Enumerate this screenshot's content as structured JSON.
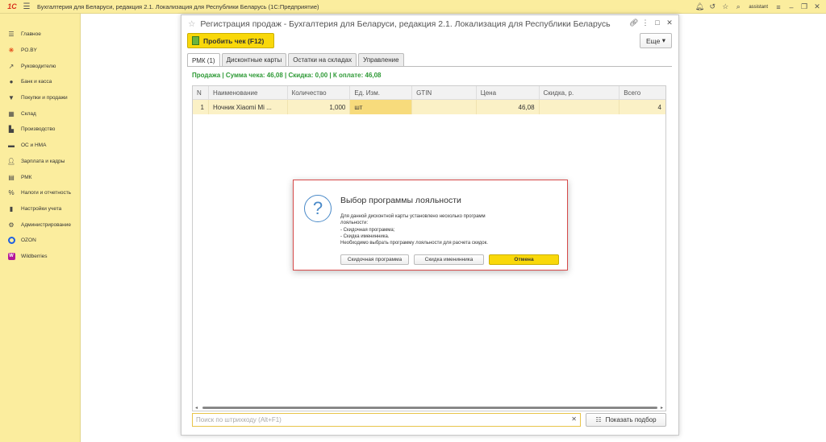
{
  "app": {
    "logo_text": "1С",
    "title": "Бухгалтерия для Беларуси, редакция 2.1. Локализация для Республики Беларусь   (1С:Предприятие)",
    "user": "assistant"
  },
  "sidebar": {
    "items": [
      {
        "label": "Главное",
        "icon": "menu-icon"
      },
      {
        "label": "PO.BY",
        "icon": "poby-icon"
      },
      {
        "label": "Руководителю",
        "icon": "chart-icon"
      },
      {
        "label": "Банк и касса",
        "icon": "bank-icon"
      },
      {
        "label": "Покупки и продажи",
        "icon": "cart-icon"
      },
      {
        "label": "Склад",
        "icon": "warehouse-icon"
      },
      {
        "label": "Производство",
        "icon": "factory-icon"
      },
      {
        "label": "ОС и НМА",
        "icon": "truck-icon"
      },
      {
        "label": "Зарплата и кадры",
        "icon": "person-icon"
      },
      {
        "label": "РМК",
        "icon": "cash-register-icon"
      },
      {
        "label": "Налоги и отчетность",
        "icon": "percent-icon"
      },
      {
        "label": "Настройки учета",
        "icon": "book-icon"
      },
      {
        "label": "Администрирование",
        "icon": "gear-icon"
      },
      {
        "label": "OZON",
        "icon": "ozon-icon"
      },
      {
        "label": "Wildberries",
        "icon": "wildberries-icon"
      }
    ]
  },
  "window": {
    "title": "Регистрация продаж - Бухгалтерия для Беларуси, редакция 2.1. Локализация для Республики Беларусь",
    "print_button": "Пробить чек (F12)",
    "more_button": "Еще",
    "tabs": [
      "РМК (1)",
      "Дисконтные карты",
      "Остатки на складах",
      "Управление"
    ],
    "summary": "Продажа | Сумма чека: 46,08 | Скидка: 0,00 | К оплате: 46,08",
    "columns": [
      "N",
      "Наименование",
      "Количество",
      "Ед. Изм.",
      "GTIN",
      "Цена",
      "Скидка, р.",
      "Всего"
    ],
    "rows": [
      {
        "n": "1",
        "name": "Ночник Xiaomi Mi ...",
        "qty": "1,000",
        "unit": "шт",
        "gtin": "",
        "price": "46,08",
        "discount": "",
        "total": "4"
      }
    ],
    "search_placeholder": "Поиск по штрихкоду (Alt+F1)",
    "show_button": "Показать подбор"
  },
  "dialog": {
    "title": "Выбор программы лояльности",
    "text_lines": [
      "Для данной дисконтной карты установлено несколько программ",
      "лояльности:",
      "- Скидочная программа;",
      "- Скидка именинника.",
      "Необходимо выбрать программу лояльности для расчета скидок."
    ],
    "buttons": [
      "Скидочная программа",
      "Скидка именинника",
      "Отмена"
    ]
  }
}
